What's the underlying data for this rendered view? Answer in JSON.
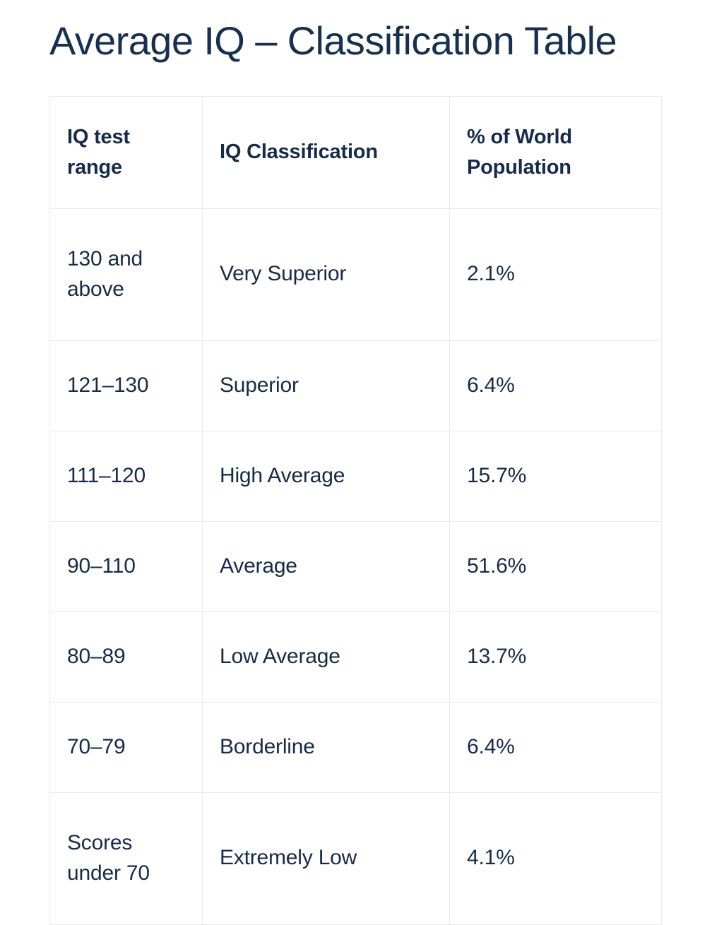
{
  "page": {
    "title": "Average IQ – Classification Table",
    "background_color": "#ffffff",
    "text_color": "#152c49",
    "border_color": "#e8eaec"
  },
  "table": {
    "name": "iq-classification-table",
    "headers": [
      "IQ test range",
      "IQ Classification",
      "% of World Population"
    ],
    "rows": [
      {
        "range": "130 and above",
        "classification": "Very Superior",
        "percent": "2.1%"
      },
      {
        "range": "121–130",
        "classification": "Superior",
        "percent": "6.4%"
      },
      {
        "range": "111–120",
        "classification": "High Average",
        "percent": "15.7%"
      },
      {
        "range": "90–110",
        "classification": "Average",
        "percent": "51.6%"
      },
      {
        "range": "80–89",
        "classification": "Low Average",
        "percent": "13.7%"
      },
      {
        "range": "70–79",
        "classification": "Borderline",
        "percent": "6.4%"
      },
      {
        "range": "Scores under 70",
        "classification": "Extremely Low",
        "percent": "4.1%"
      }
    ]
  },
  "chart_data": {
    "type": "table",
    "title": "Average IQ – Classification Table",
    "columns": [
      "IQ test range",
      "IQ Classification",
      "% of World Population"
    ],
    "categories": [
      "Very Superior",
      "Superior",
      "High Average",
      "Average",
      "Low Average",
      "Borderline",
      "Extremely Low"
    ],
    "values": [
      2.1,
      6.4,
      15.7,
      51.6,
      13.7,
      6.4,
      4.1
    ],
    "ranges": [
      "130 and above",
      "121–130",
      "111–120",
      "90–110",
      "80–89",
      "70–79",
      "Scores under 70"
    ],
    "xlabel": "IQ Classification",
    "ylabel": "% of World Population",
    "ylim": [
      0,
      100
    ],
    "grid": false,
    "legend": "none"
  }
}
